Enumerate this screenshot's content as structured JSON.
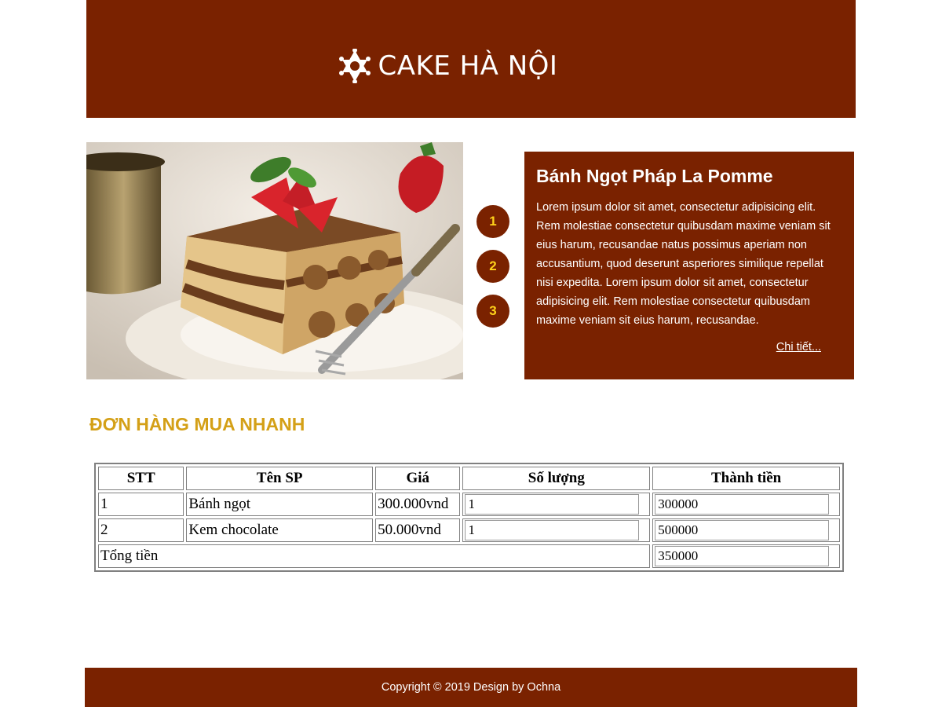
{
  "header": {
    "brand": "CAKE HÀ NỘI",
    "logo_icon": "star-of-david-icon"
  },
  "hero": {
    "image": "tiramisu-cake-image"
  },
  "slider": {
    "dots": [
      "1",
      "2",
      "3"
    ]
  },
  "info": {
    "title": "Bánh Ngọt Pháp La Pomme",
    "description": "Lorem ipsum dolor sit amet, consectetur adipisicing elit. Rem molestiae consectetur quibusdam maxime veniam sit eius harum, recusandae natus possimus aperiam non accusantium, quod deserunt asperiores similique repellat nisi expedita. Lorem ipsum dolor sit amet, consectetur adipisicing elit. Rem molestiae consectetur quibusdam maxime veniam sit eius harum, recusandae.",
    "link": "Chi tiết..."
  },
  "order": {
    "title": "ĐƠN HÀNG MUA NHANH",
    "headers": [
      "STT",
      "Tên SP",
      "Giá",
      "Số lượng",
      "Thành tiền"
    ],
    "rows": [
      {
        "stt": "1",
        "name": "Bánh ngọt",
        "price": "300.000vnd",
        "qty": "1",
        "total": "300000"
      },
      {
        "stt": "2",
        "name": "Kem chocolate",
        "price": "50.000vnd",
        "qty": "1",
        "total": "500000"
      }
    ],
    "sum_label": "Tổng tiền",
    "sum_value": "350000"
  },
  "footer": {
    "text": "Copyright © 2019 Design by Ochna"
  },
  "colors": {
    "brand": "#7a2200",
    "accent": "#d4a017",
    "dot_text": "#ffd21a"
  }
}
